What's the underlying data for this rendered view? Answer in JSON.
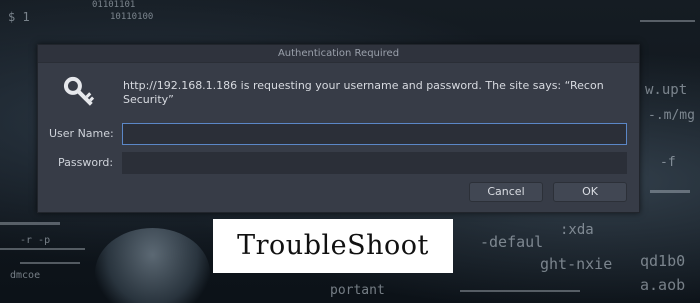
{
  "background": {
    "code_fragments": [
      "01101101",
      "10110100",
      "$ 1",
      "w.upt",
      "-.m/mg",
      "-f",
      ":xda",
      "-defaul",
      "ght-nxie",
      "qd1b0",
      "portant",
      "a.aob",
      "-r -p",
      "dmcoe"
    ]
  },
  "dialog": {
    "title": "Authentication Required",
    "message": "http://192.168.1.186 is requesting your username and password. The site says: “Recon Security”",
    "username_label": "User Name:",
    "username_value": "",
    "password_label": "Password:",
    "password_value": "",
    "cancel_label": "Cancel",
    "ok_label": "OK",
    "icon": "key-icon"
  },
  "caption": {
    "text": "TroubleShoot"
  },
  "colors": {
    "dialog_bg": "#373c47",
    "titlebar_bg": "#2f333d",
    "focus_border": "#5b87c7",
    "caption_bg": "#ffffff"
  }
}
